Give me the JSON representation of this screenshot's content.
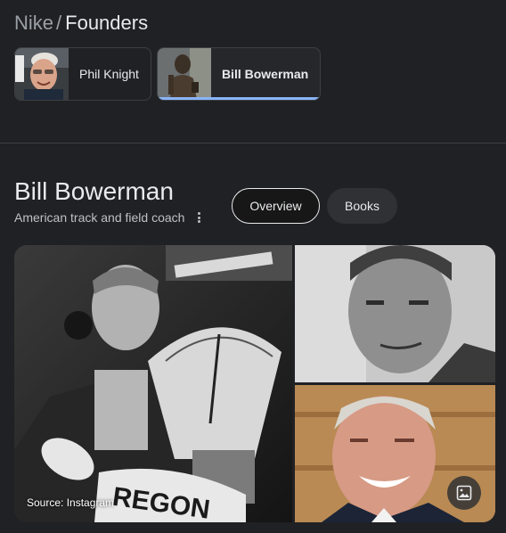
{
  "breadcrumb": {
    "parent": "Nike",
    "separator": "/",
    "current": "Founders"
  },
  "founders": [
    {
      "label": "Phil Knight",
      "active": false
    },
    {
      "label": "Bill Bowerman",
      "active": true
    }
  ],
  "entity": {
    "name": "Bill Bowerman",
    "description": "American track and field coach"
  },
  "tabs": {
    "overview": "Overview",
    "books": "Books"
  },
  "gallery": {
    "source_caption": "Source: Instagram",
    "main_image_sign_text": "REGON"
  },
  "colors": {
    "background": "#202124",
    "active_indicator": "#8ab4f8",
    "chip_border": "#3c4043"
  },
  "icons": {
    "more": "more-vert-icon",
    "image": "image-icon"
  }
}
